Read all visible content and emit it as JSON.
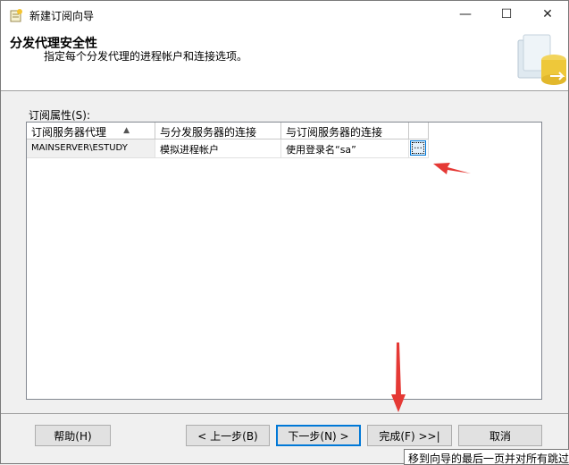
{
  "window": {
    "title": "新建订阅向导",
    "controls": {
      "minimize": "—",
      "maximize": "☐",
      "close": "✕"
    }
  },
  "header": {
    "title": "分发代理安全性",
    "description": "指定每个分发代理的进程帐户和连接选项。"
  },
  "section": {
    "label": "订阅属性(S):"
  },
  "grid": {
    "columns": [
      "订阅服务器代理",
      "与分发服务器的连接",
      "与订阅服务器的连接",
      ""
    ],
    "rows": [
      {
        "agent": "MAINSERVER\\ESTUDY",
        "distributor_conn": "模拟进程帐户",
        "subscriber_conn": "使用登录名“sa”",
        "action": "..."
      }
    ]
  },
  "buttons": {
    "help": "帮助(H)",
    "back": "< 上一步(B)",
    "next": "下一步(N) >",
    "finish": "完成(F) >>|",
    "cancel": "取消"
  },
  "tooltip": "移到向导的最后一页并对所有跳过",
  "colors": {
    "arrow": "#e53935",
    "accent": "#0078d7"
  }
}
